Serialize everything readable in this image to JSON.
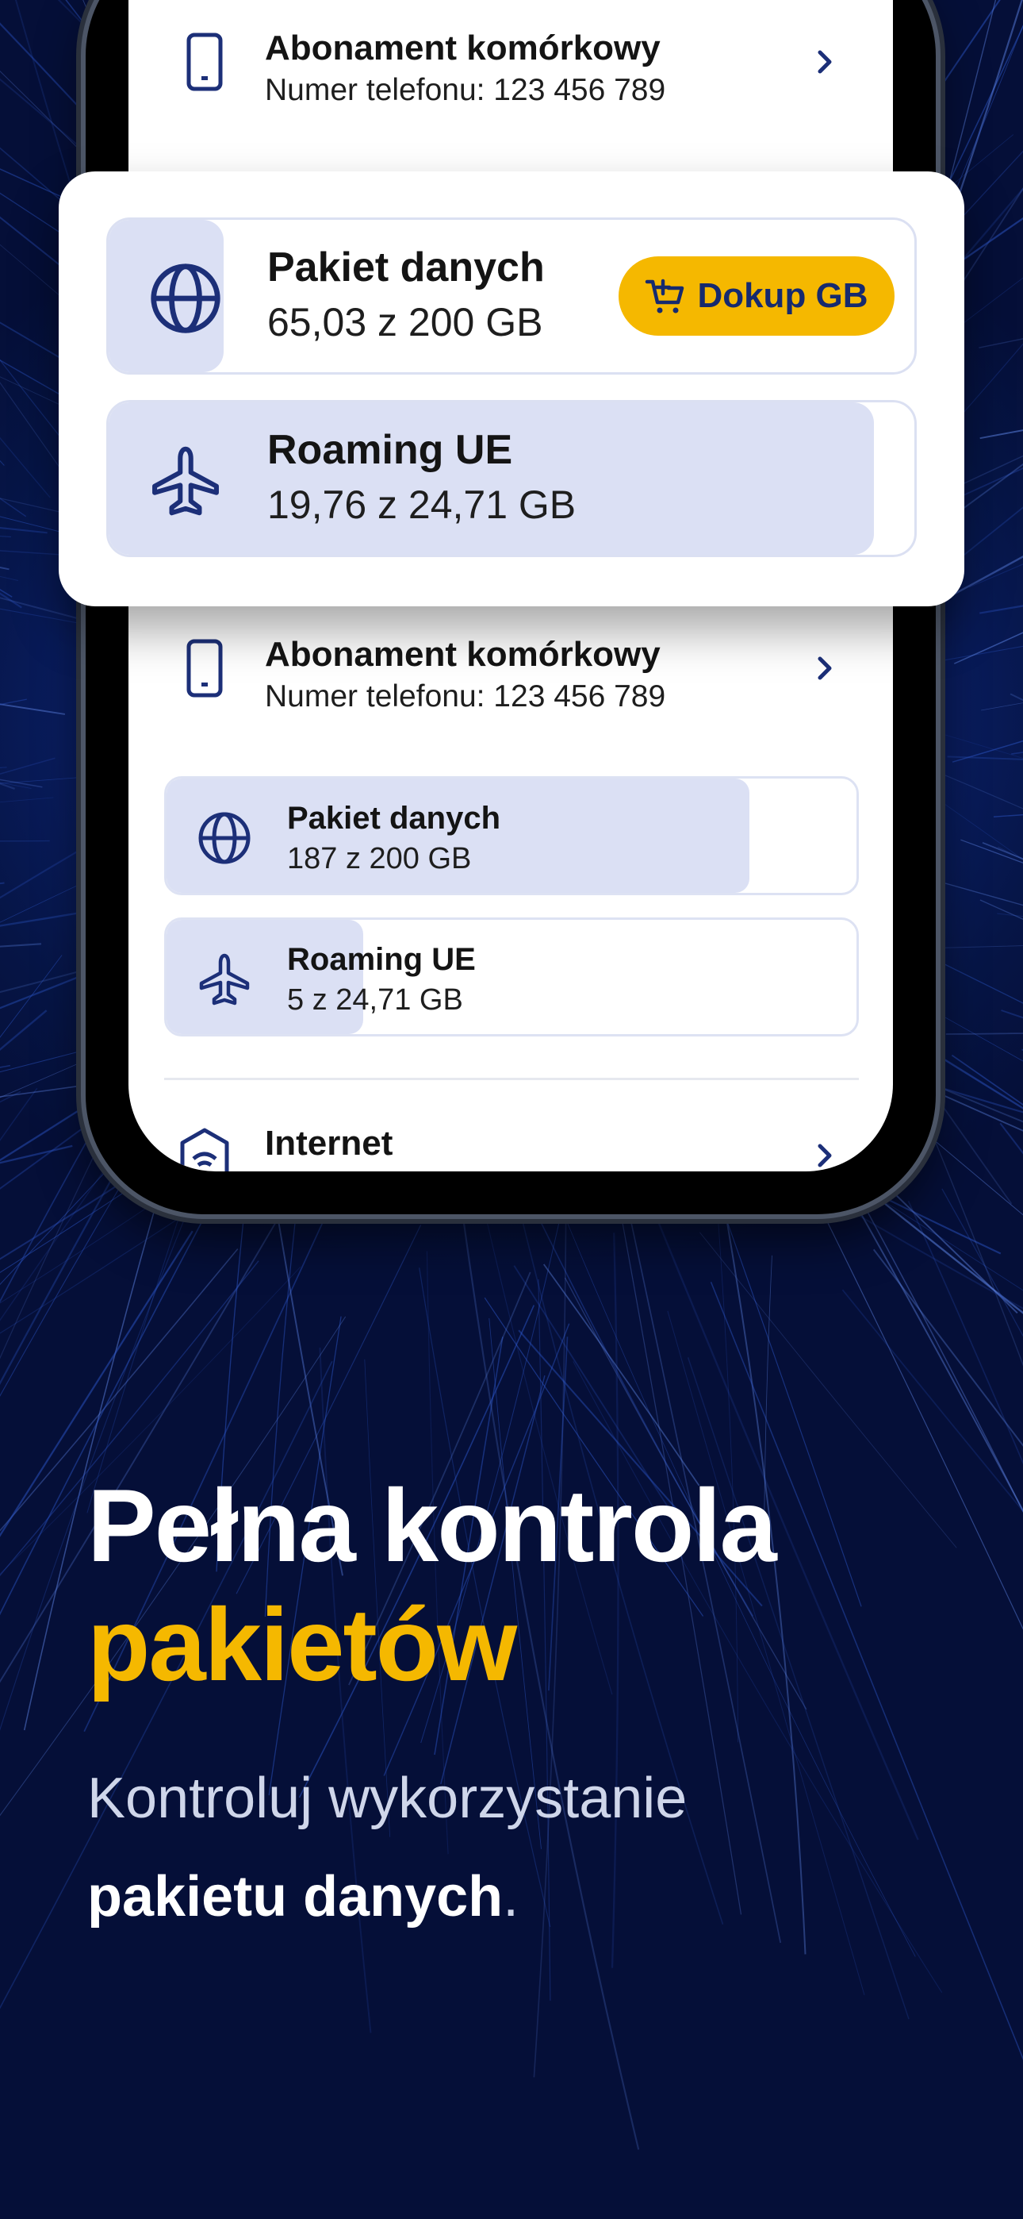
{
  "colors": {
    "accent_yellow": "#f5b800",
    "navy": "#162a6e",
    "fill": "#dbe0f4",
    "background": "#061546"
  },
  "phone": {
    "rows": [
      {
        "title": "Abonament komórkowy",
        "subtitle": "Numer telefonu: 123 456 789",
        "icon": "phone-icon"
      },
      {
        "title": "Abonament komórkowy",
        "subtitle": "Numer telefonu: 123 456 789",
        "icon": "phone-icon"
      },
      {
        "title": "Internet",
        "icon": "router-icon"
      }
    ],
    "packages": [
      {
        "title": "Pakiet danych",
        "usage": "187 z 200 GB",
        "fill": 0.845,
        "icon": "globe-icon"
      },
      {
        "title": "Roaming UE",
        "usage": "5 z 24,71 GB",
        "fill": 0.285,
        "icon": "plane-icon"
      }
    ]
  },
  "card": {
    "data": {
      "title": "Pakiet danych",
      "usage": "65,03 z 200 GB",
      "fill": 0.143,
      "icon": "globe-icon"
    },
    "roaming": {
      "title": "Roaming UE",
      "usage": "19,76 z 24,71 GB",
      "fill": 0.95,
      "icon": "plane-icon"
    },
    "topup_label": "Dokup GB"
  },
  "headline": {
    "line1": "Pełna kontrola",
    "line2": "pakietów"
  },
  "lead": {
    "line1": "Kontroluj wykorzystanie",
    "line2_bold": "pakietu danych",
    "line2_end": "."
  }
}
